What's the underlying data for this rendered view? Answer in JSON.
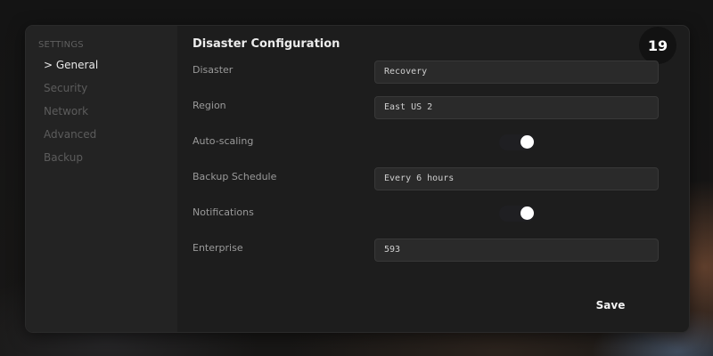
{
  "sidebar": {
    "heading": "SETTINGS",
    "items": [
      {
        "label": "> General",
        "active": true
      },
      {
        "label": "Security",
        "active": false
      },
      {
        "label": "Network",
        "active": false
      },
      {
        "label": "Advanced",
        "active": false
      },
      {
        "label": "Backup",
        "active": false
      }
    ]
  },
  "main": {
    "title": "Disaster Configuration",
    "badge": "19",
    "fields": {
      "disaster": {
        "label": "Disaster",
        "value": "Recovery"
      },
      "region": {
        "label": "Region",
        "value": "East US 2"
      },
      "auto_scaling": {
        "label": "Auto-scaling",
        "on": true
      },
      "backup_schedule": {
        "label": "Backup Schedule",
        "value": "Every 6 hours"
      },
      "notifications": {
        "label": "Notifications",
        "on": true
      },
      "enterprise": {
        "label": "Enterprise",
        "value": "593"
      }
    },
    "save_label": "Save"
  },
  "colors": {
    "panel": "#1d1d1d",
    "sidebar": "#232323",
    "input_bg": "#2a2a2a",
    "active_text": "#e8e8e8",
    "toggle_knob": "#ffffff"
  }
}
